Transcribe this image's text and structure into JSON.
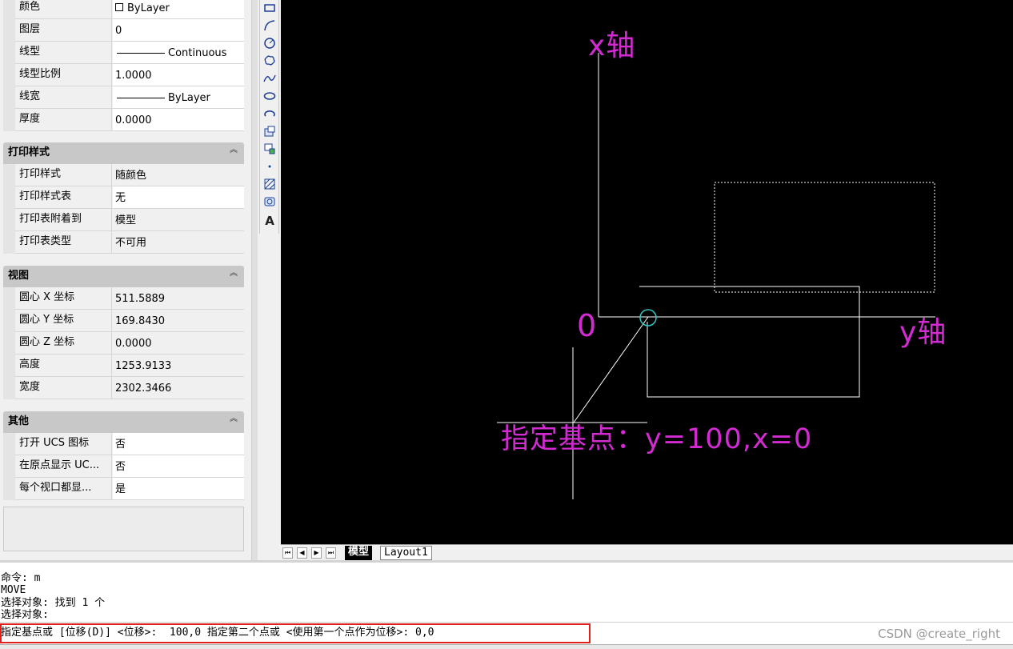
{
  "properties": {
    "general": [
      {
        "name": "颜色",
        "value": "ByLayer",
        "swatch": true
      },
      {
        "name": "图层",
        "value": "0"
      },
      {
        "name": "线型",
        "value": "Continuous",
        "sample": true
      },
      {
        "name": "线型比例",
        "value": "1.0000"
      },
      {
        "name": "线宽",
        "value": "ByLayer",
        "sample": true
      },
      {
        "name": "厚度",
        "value": "0.0000"
      }
    ],
    "print_style": {
      "title": "打印样式",
      "rows": [
        {
          "name": "打印样式",
          "value": "随颜色"
        },
        {
          "name": "打印样式表",
          "value": "无"
        },
        {
          "name": "打印表附着到",
          "value": "模型"
        },
        {
          "name": "打印表类型",
          "value": "不可用"
        }
      ]
    },
    "view": {
      "title": "视图",
      "rows": [
        {
          "name": "圆心 X 坐标",
          "value": "511.5889"
        },
        {
          "name": "圆心 Y 坐标",
          "value": "169.8430"
        },
        {
          "name": "圆心 Z 坐标",
          "value": "0.0000"
        },
        {
          "name": "高度",
          "value": "1253.9133"
        },
        {
          "name": "宽度",
          "value": "2302.3466"
        }
      ]
    },
    "misc": {
      "title": "其他",
      "rows": [
        {
          "name": "打开 UCS 图标",
          "value": "否"
        },
        {
          "name": "在原点显示 UC...",
          "value": "否"
        },
        {
          "name": "每个视口都显...",
          "value": "是"
        }
      ]
    }
  },
  "draw_toolbar": [
    "rectangle-icon",
    "arc-icon",
    "circle-icon",
    "revision-cloud-icon",
    "spline-icon",
    "ellipse-icon",
    "ellipse-arc-icon",
    "insert-block-icon",
    "make-block-icon",
    "point-icon",
    "hatch-icon",
    "region-icon",
    "mtext-icon"
  ],
  "canvas": {
    "labels": {
      "x_axis": "x轴",
      "y_axis": "y轴",
      "origin": "0",
      "annotation": "指定基点：y=100,x=0"
    },
    "text_color": "#d22bd2",
    "line_color": "#ffffff",
    "grip_color": "#35c4c4"
  },
  "tabs": {
    "nav": [
      "⏮",
      "◀",
      "▶",
      "⏭"
    ],
    "model": "模型",
    "layout1": "Layout1"
  },
  "command_line": {
    "lines": [
      "命令: m",
      "MOVE",
      "选择对象: 找到 1 个",
      "选择对象:"
    ],
    "current": "指定基点或 [位移(D)] <位移>:  100,0 指定第二个点或 <使用第一个点作为位移>: 0,0",
    "highlight_color": "#e0201c"
  },
  "watermark": "CSDN @create_right"
}
